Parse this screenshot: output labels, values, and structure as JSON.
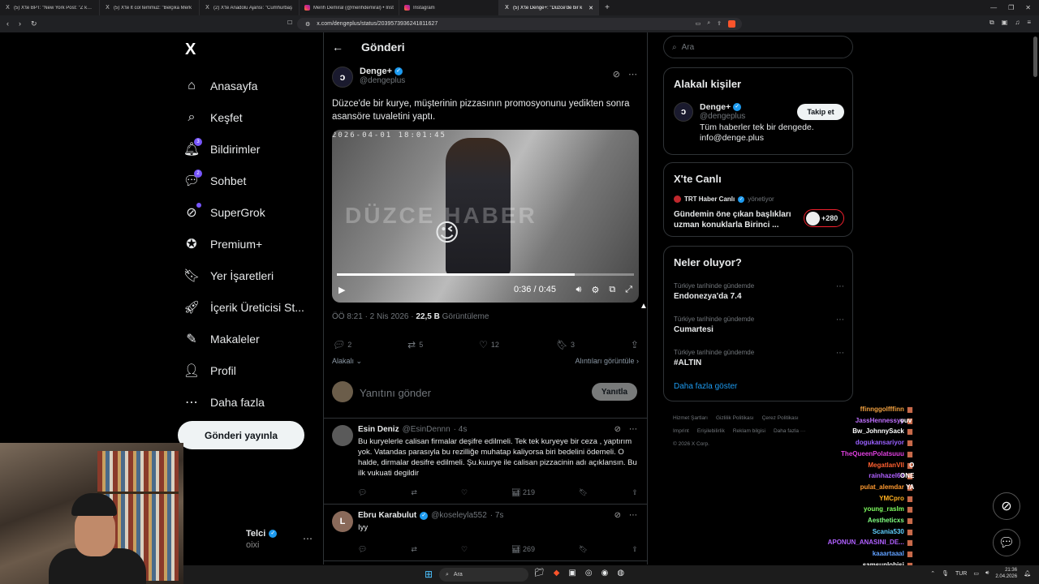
{
  "browser": {
    "tabs": [
      {
        "icon": "X",
        "title": "(5) X'te BPT: \"New York Post: \"Z kuşağ",
        "active": false
      },
      {
        "icon": "X",
        "title": "(5) X'te lt col temmuz: \"Belçika Merk",
        "active": false
      },
      {
        "icon": "X",
        "title": "(2) X'te Anadolu Ajansı: \"Cumhurbaş",
        "active": false
      },
      {
        "icon": "ig",
        "title": "Merih Demiral (@merihdemiral) • Inst",
        "active": false
      },
      {
        "icon": "ig",
        "title": "Instagram",
        "active": false
      },
      {
        "icon": "X",
        "title": "(5) X'te Denge+: \"Düzce'de bir k",
        "active": true
      }
    ],
    "new_tab": "+",
    "url": "x.com/dengeplus/status/2039573936241811627"
  },
  "sidebar": {
    "logo": "X",
    "items": [
      {
        "label": "Anasayfa",
        "icon": "home-icon",
        "glyph": "⌂",
        "badge": ""
      },
      {
        "label": "Keşfet",
        "icon": "search-icon",
        "glyph": "⌕",
        "badge": ""
      },
      {
        "label": "Bildirimler",
        "icon": "bell-icon",
        "glyph": "🔔︎",
        "badge": "3"
      },
      {
        "label": "Sohbet",
        "icon": "chat-icon",
        "glyph": "💬︎",
        "badge": "2"
      },
      {
        "label": "SuperGrok",
        "icon": "grok-icon",
        "glyph": "⊘",
        "badge": "dot"
      },
      {
        "label": "Premium+",
        "icon": "premium-icon",
        "glyph": "✪",
        "badge": ""
      },
      {
        "label": "Yer İşaretleri",
        "icon": "bookmark-icon",
        "glyph": "🔖︎",
        "badge": ""
      },
      {
        "label": "İçerik Üreticisi St...",
        "icon": "rocket-icon",
        "glyph": "🚀︎",
        "badge": ""
      },
      {
        "label": "Makaleler",
        "icon": "article-icon",
        "glyph": "✎",
        "badge": ""
      },
      {
        "label": "Profil",
        "icon": "profile-icon",
        "glyph": "👤︎",
        "badge": ""
      },
      {
        "label": "Daha fazla",
        "icon": "more-icon",
        "glyph": "⋯",
        "badge": ""
      }
    ],
    "post_button": "Gönderi yayınla",
    "profile_name": "Telci",
    "profile_sub": "oixi"
  },
  "main": {
    "title": "Gönderi",
    "author": {
      "name": "Denge+",
      "handle": "@dengeplus"
    },
    "text": "Düzce'de bir kurye, müşterinin pizzasının promosyonunu yedikten sonra asansöre tuvaletini yaptı.",
    "video": {
      "timestamp": "2026-04-01 18:01:45",
      "watermark": "DÜZCE HABER",
      "current": "0:36",
      "duration": "0:45",
      "progress": 0.8
    },
    "meta": {
      "time": "ÖÖ 8:21 · 2 Nis 2026 · ",
      "views": "22,5 B",
      "views_label": " Görüntüleme"
    },
    "actions": {
      "replies": "2",
      "reposts": "5",
      "likes": "12",
      "bookmarks": "3"
    },
    "sort_label": "Alakalı",
    "quotes_label": "Alıntıları görüntüle",
    "reply_placeholder": "Yanıtını gönder",
    "reply_button": "Yanıtla",
    "comments": [
      {
        "name": "Esin Deniz",
        "handle": "@EsinDennn",
        "time": "· 4s",
        "verified": false,
        "text": "Bu kuryelerle calisan firmalar deşifre edilmeli. Tek tek kuryeye bir ceza , yaptırım yok. Vatandas parasıyla bu rezilliğe muhatap kaliyorsa biri bedelini ödemeli. O halde, dirmalar desifre edilmeli. Şu.kuurye ile calisan pizzacinin adı açıklansın. Bu ilk vukuati degildir",
        "views": "219",
        "color": "#5a5a5a",
        "initial": ""
      },
      {
        "name": "Ebru Karabulut",
        "handle": "@koseleyla552",
        "time": "· 7s",
        "verified": true,
        "text": "Iyy",
        "views": "269",
        "color": "#8a6a5a",
        "initial": "L"
      }
    ]
  },
  "right": {
    "search_placeholder": "Ara",
    "related": {
      "title": "Alakalı kişiler",
      "name": "Denge+",
      "handle": "@dengeplus",
      "bio": "Tüm haberler tek bir dengede. info@denge.plus",
      "follow": "Takip et"
    },
    "live": {
      "title": "X'te Canlı",
      "host": "TRT Haber Canlı",
      "role": "yönetiyor",
      "text": "Gündemin öne çıkan başlıkları uzman konuklarla Birinci ...",
      "count": "+280"
    },
    "trends": {
      "title": "Neler oluyor?",
      "items": [
        {
          "context": "Türkiye tarihinde gündemde",
          "name": "Endonezya'da 7.4"
        },
        {
          "context": "Türkiye tarihinde gündemde",
          "name": "Cumartesi"
        },
        {
          "context": "Türkiye tarihinde gündemde",
          "name": "#ALTIN"
        }
      ],
      "show_more": "Daha fazla göster"
    },
    "footer": [
      "Hizmet Şartları",
      "Gizlilik Politikası",
      "Çerez Politikası",
      "Imprint",
      "Erişilebilirlik",
      "Reklam bilgisi",
      "Daha fazla ···",
      "© 2026 X Corp."
    ]
  },
  "chat": [
    {
      "user": "ffinnggolfffinn",
      "color": "#f0a040",
      "msg": ""
    },
    {
      "user": "JassHennessyy",
      "color": "#c070ff",
      "msg": "ouv"
    },
    {
      "user": "Bw_JohnnySack",
      "color": "#ffffff",
      "msg": ""
    },
    {
      "user": "dogukansariyor",
      "color": "#9a60ff",
      "msg": ""
    },
    {
      "user": "TheQueenPolatsuuu",
      "color": "#e040e0",
      "msg": ""
    },
    {
      "user": "MegatlanVII",
      "color": "#ff6030",
      "msg": "O ONE YA"
    },
    {
      "user": "rainhazel63",
      "color": "#b060ff",
      "msg": ""
    },
    {
      "user": "pulat_alemdar",
      "color": "#ff9a30",
      "msg": ""
    },
    {
      "user": "YMCpro",
      "color": "#ffb020",
      "msg": ""
    },
    {
      "user": "young_raslm",
      "color": "#80ff60",
      "msg": ""
    },
    {
      "user": "Aestheticxs",
      "color": "#80ff80",
      "msg": ""
    },
    {
      "user": "Scania530",
      "color": "#60d0ff",
      "msg": ""
    },
    {
      "user": "APONUN_ANASINI_DE...",
      "color": "#b060ff",
      "msg": ""
    },
    {
      "user": "kaaartaaal",
      "color": "#60a0ff",
      "msg": ""
    },
    {
      "user": "samsunlobisi",
      "color": "#ffffff",
      "msg": ""
    }
  ],
  "taskbar": {
    "search": "Ara",
    "lang": "TUR",
    "time": "21:36",
    "date": "2.04.2026"
  },
  "colors": {
    "accent": "#1d9bf0",
    "badge": "#7856ff",
    "bg": "#000000",
    "border": "#2f3336"
  }
}
